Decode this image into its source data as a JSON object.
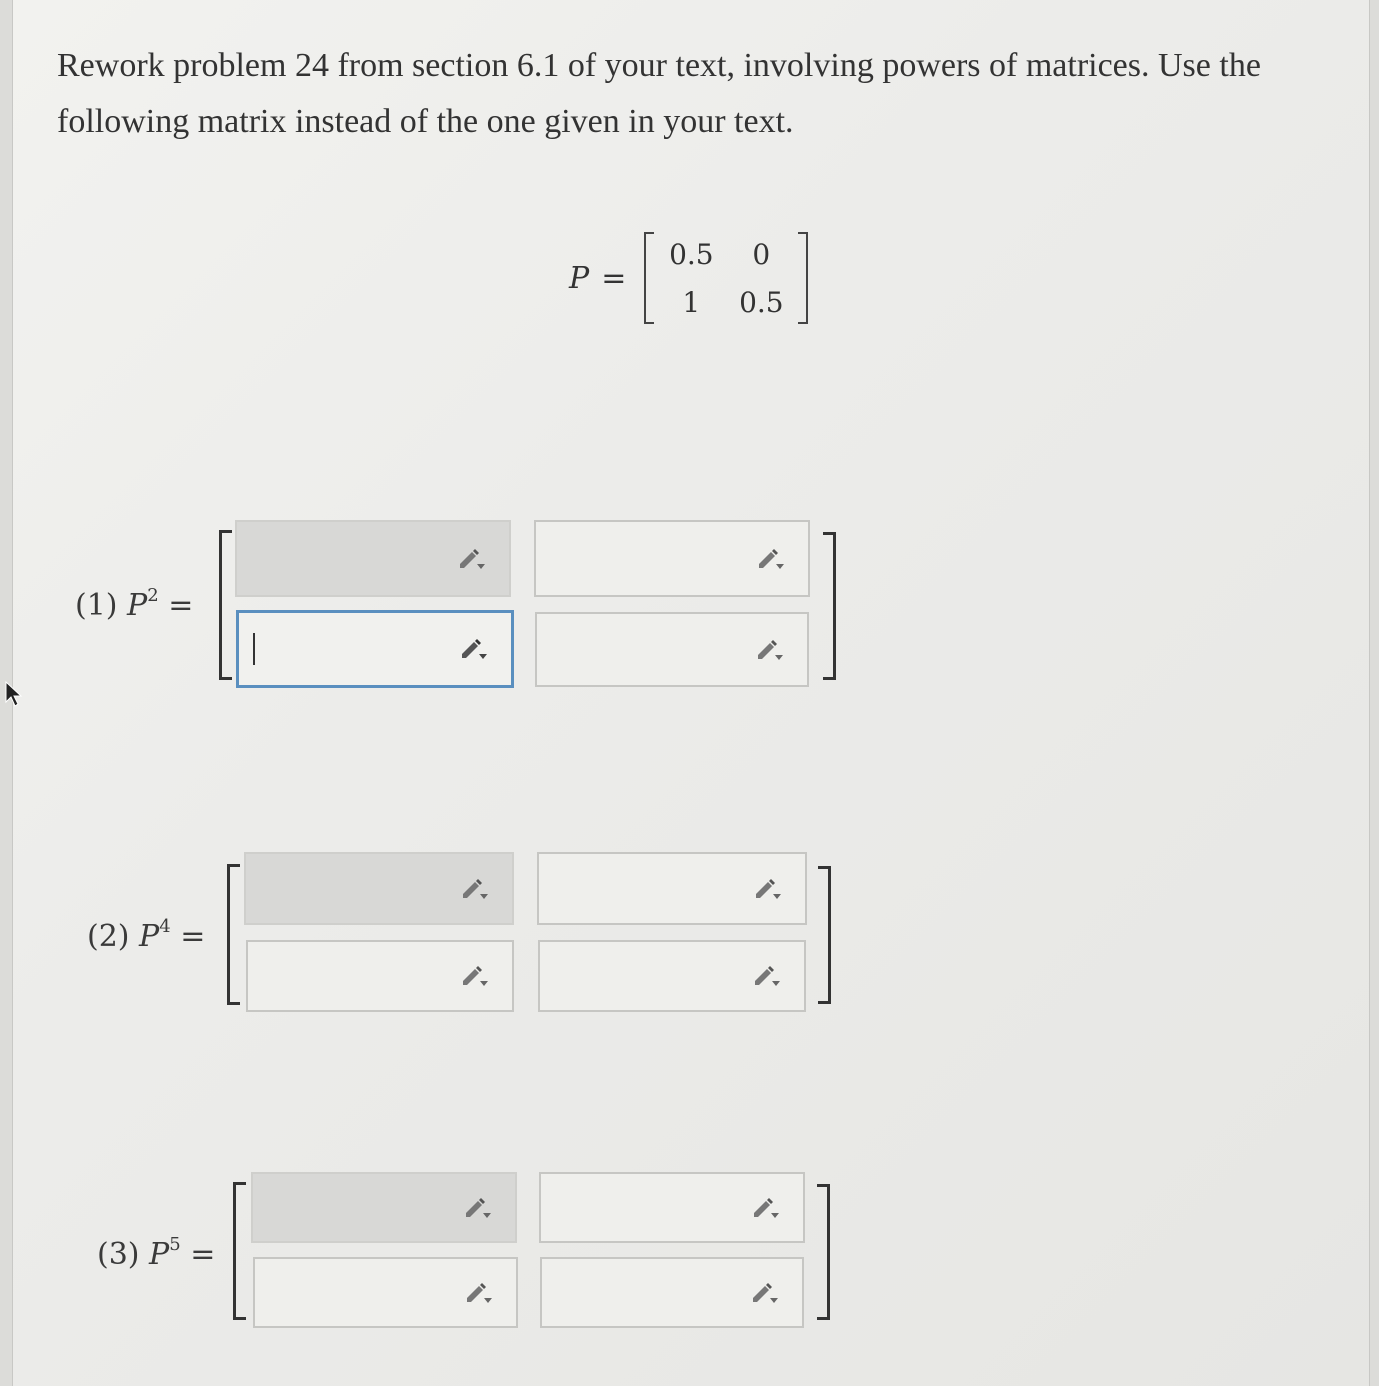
{
  "prompt": {
    "text": "Rework problem 24 from section 6.1 of your text, involving powers of matrices. Use the following matrix instead of the one given in your text."
  },
  "given_matrix": {
    "name": "P",
    "equals": "=",
    "entries": [
      "0.5",
      "0",
      "1",
      "0.5"
    ]
  },
  "answers": [
    {
      "number": "(1)",
      "var": "P",
      "power": "2",
      "equals": "="
    },
    {
      "number": "(2)",
      "var": "P",
      "power": "4",
      "equals": "="
    },
    {
      "number": "(3)",
      "var": "P",
      "power": "5",
      "equals": "="
    }
  ],
  "icons": {
    "cell_tool": "pencil-dropdown-icon",
    "cursor": "mouse-pointer-icon"
  },
  "colors": {
    "focus_border": "#5a8fbf",
    "filled_cell": "#d8d8d6"
  }
}
